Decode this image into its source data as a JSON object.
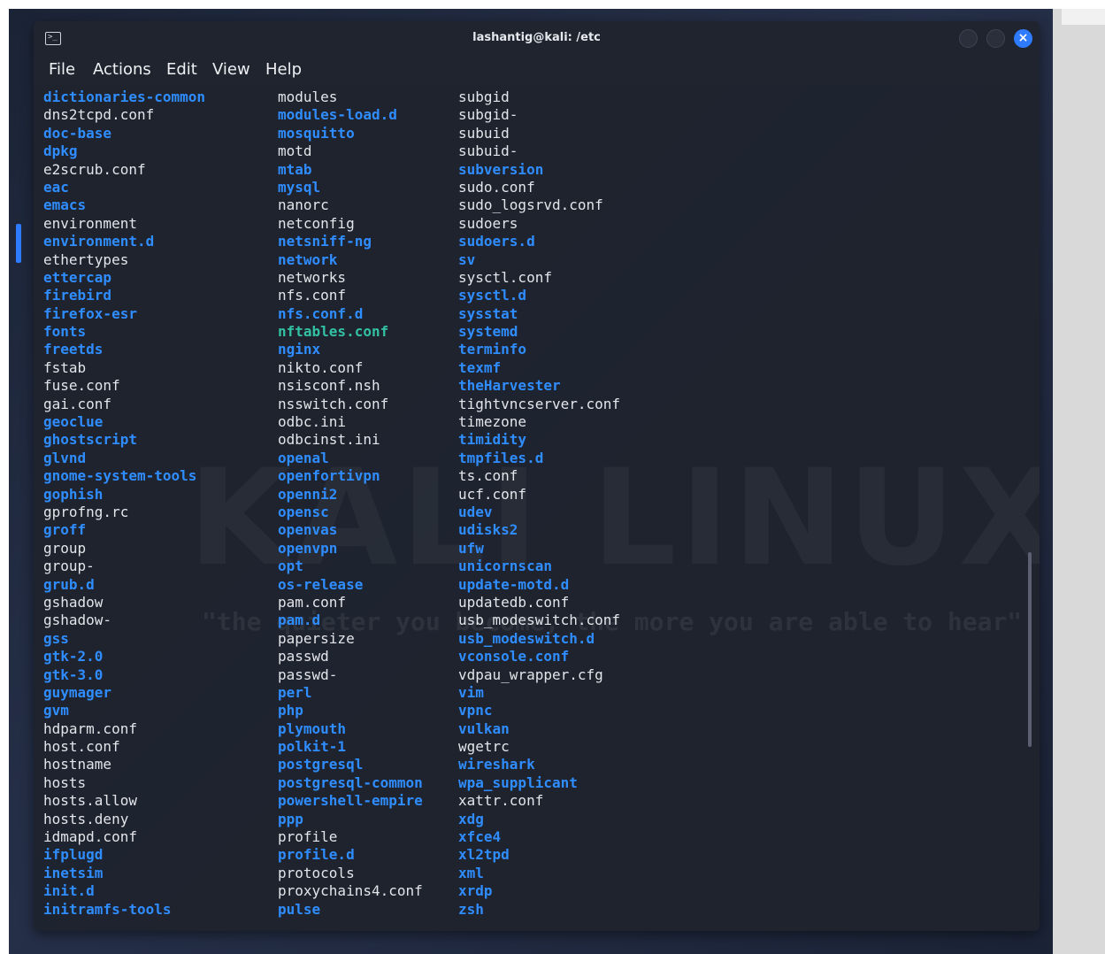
{
  "window": {
    "title": "lashantig@kali: /etc",
    "close_symbol": "×"
  },
  "menu": [
    "File",
    "Actions",
    "Edit",
    "View",
    "Help"
  ],
  "watermark": "KALI LINUX",
  "quote": "\"the quieter you become, the more you are able to hear\"",
  "colors": {
    "directory": "#2f8dff",
    "file": "#e3e5ea",
    "symlink": "#33c1a4",
    "accent": "#2f7bff"
  },
  "columns": [
    [
      {
        "name": "dictionaries-common",
        "type": "dir"
      },
      {
        "name": "dns2tcpd.conf",
        "type": "file"
      },
      {
        "name": "doc-base",
        "type": "dir"
      },
      {
        "name": "dpkg",
        "type": "dir"
      },
      {
        "name": "e2scrub.conf",
        "type": "file"
      },
      {
        "name": "eac",
        "type": "dir"
      },
      {
        "name": "emacs",
        "type": "dir"
      },
      {
        "name": "environment",
        "type": "file"
      },
      {
        "name": "environment.d",
        "type": "dir"
      },
      {
        "name": "ethertypes",
        "type": "file"
      },
      {
        "name": "ettercap",
        "type": "dir"
      },
      {
        "name": "firebird",
        "type": "dir"
      },
      {
        "name": "firefox-esr",
        "type": "dir"
      },
      {
        "name": "fonts",
        "type": "dir"
      },
      {
        "name": "freetds",
        "type": "dir"
      },
      {
        "name": "fstab",
        "type": "file"
      },
      {
        "name": "fuse.conf",
        "type": "file"
      },
      {
        "name": "gai.conf",
        "type": "file"
      },
      {
        "name": "geoclue",
        "type": "dir"
      },
      {
        "name": "ghostscript",
        "type": "dir"
      },
      {
        "name": "glvnd",
        "type": "dir"
      },
      {
        "name": "gnome-system-tools",
        "type": "dir"
      },
      {
        "name": "gophish",
        "type": "dir"
      },
      {
        "name": "gprofng.rc",
        "type": "file"
      },
      {
        "name": "groff",
        "type": "dir"
      },
      {
        "name": "group",
        "type": "file"
      },
      {
        "name": "group-",
        "type": "file"
      },
      {
        "name": "grub.d",
        "type": "dir"
      },
      {
        "name": "gshadow",
        "type": "file"
      },
      {
        "name": "gshadow-",
        "type": "file"
      },
      {
        "name": "gss",
        "type": "dir"
      },
      {
        "name": "gtk-2.0",
        "type": "dir"
      },
      {
        "name": "gtk-3.0",
        "type": "dir"
      },
      {
        "name": "guymager",
        "type": "dir"
      },
      {
        "name": "gvm",
        "type": "dir"
      },
      {
        "name": "hdparm.conf",
        "type": "file"
      },
      {
        "name": "host.conf",
        "type": "file"
      },
      {
        "name": "hostname",
        "type": "file"
      },
      {
        "name": "hosts",
        "type": "file"
      },
      {
        "name": "hosts.allow",
        "type": "file"
      },
      {
        "name": "hosts.deny",
        "type": "file"
      },
      {
        "name": "idmapd.conf",
        "type": "file"
      },
      {
        "name": "ifplugd",
        "type": "dir"
      },
      {
        "name": "inetsim",
        "type": "dir"
      },
      {
        "name": "init.d",
        "type": "dir"
      },
      {
        "name": "initramfs-tools",
        "type": "dir"
      }
    ],
    [
      {
        "name": "modules",
        "type": "file"
      },
      {
        "name": "modules-load.d",
        "type": "dir"
      },
      {
        "name": "mosquitto",
        "type": "dir"
      },
      {
        "name": "motd",
        "type": "file"
      },
      {
        "name": "mtab",
        "type": "dir"
      },
      {
        "name": "mysql",
        "type": "dir"
      },
      {
        "name": "nanorc",
        "type": "file"
      },
      {
        "name": "netconfig",
        "type": "file"
      },
      {
        "name": "netsniff-ng",
        "type": "dir"
      },
      {
        "name": "network",
        "type": "dir"
      },
      {
        "name": "networks",
        "type": "file"
      },
      {
        "name": "nfs.conf",
        "type": "file"
      },
      {
        "name": "nfs.conf.d",
        "type": "dir"
      },
      {
        "name": "nftables.conf",
        "type": "link"
      },
      {
        "name": "nginx",
        "type": "dir"
      },
      {
        "name": "nikto.conf",
        "type": "file"
      },
      {
        "name": "nsisconf.nsh",
        "type": "file"
      },
      {
        "name": "nsswitch.conf",
        "type": "file"
      },
      {
        "name": "odbc.ini",
        "type": "file"
      },
      {
        "name": "odbcinst.ini",
        "type": "file"
      },
      {
        "name": "openal",
        "type": "dir"
      },
      {
        "name": "openfortivpn",
        "type": "dir"
      },
      {
        "name": "openni2",
        "type": "dir"
      },
      {
        "name": "opensc",
        "type": "dir"
      },
      {
        "name": "openvas",
        "type": "dir"
      },
      {
        "name": "openvpn",
        "type": "dir"
      },
      {
        "name": "opt",
        "type": "dir"
      },
      {
        "name": "os-release",
        "type": "dir"
      },
      {
        "name": "pam.conf",
        "type": "file"
      },
      {
        "name": "pam.d",
        "type": "dir"
      },
      {
        "name": "papersize",
        "type": "file"
      },
      {
        "name": "passwd",
        "type": "file"
      },
      {
        "name": "passwd-",
        "type": "file"
      },
      {
        "name": "perl",
        "type": "dir"
      },
      {
        "name": "php",
        "type": "dir"
      },
      {
        "name": "plymouth",
        "type": "dir"
      },
      {
        "name": "polkit-1",
        "type": "dir"
      },
      {
        "name": "postgresql",
        "type": "dir"
      },
      {
        "name": "postgresql-common",
        "type": "dir"
      },
      {
        "name": "powershell-empire",
        "type": "dir"
      },
      {
        "name": "ppp",
        "type": "dir"
      },
      {
        "name": "profile",
        "type": "file"
      },
      {
        "name": "profile.d",
        "type": "dir"
      },
      {
        "name": "protocols",
        "type": "file"
      },
      {
        "name": "proxychains4.conf",
        "type": "file"
      },
      {
        "name": "pulse",
        "type": "dir"
      }
    ],
    [
      {
        "name": "subgid",
        "type": "file"
      },
      {
        "name": "subgid-",
        "type": "file"
      },
      {
        "name": "subuid",
        "type": "file"
      },
      {
        "name": "subuid-",
        "type": "file"
      },
      {
        "name": "subversion",
        "type": "dir"
      },
      {
        "name": "sudo.conf",
        "type": "file"
      },
      {
        "name": "sudo_logsrvd.conf",
        "type": "file"
      },
      {
        "name": "sudoers",
        "type": "file"
      },
      {
        "name": "sudoers.d",
        "type": "dir"
      },
      {
        "name": "sv",
        "type": "dir"
      },
      {
        "name": "sysctl.conf",
        "type": "file"
      },
      {
        "name": "sysctl.d",
        "type": "dir"
      },
      {
        "name": "sysstat",
        "type": "dir"
      },
      {
        "name": "systemd",
        "type": "dir"
      },
      {
        "name": "terminfo",
        "type": "dir"
      },
      {
        "name": "texmf",
        "type": "dir"
      },
      {
        "name": "theHarvester",
        "type": "dir"
      },
      {
        "name": "tightvncserver.conf",
        "type": "file"
      },
      {
        "name": "timezone",
        "type": "file"
      },
      {
        "name": "timidity",
        "type": "dir"
      },
      {
        "name": "tmpfiles.d",
        "type": "dir"
      },
      {
        "name": "ts.conf",
        "type": "file"
      },
      {
        "name": "ucf.conf",
        "type": "file"
      },
      {
        "name": "udev",
        "type": "dir"
      },
      {
        "name": "udisks2",
        "type": "dir"
      },
      {
        "name": "ufw",
        "type": "dir"
      },
      {
        "name": "unicornscan",
        "type": "dir"
      },
      {
        "name": "update-motd.d",
        "type": "dir"
      },
      {
        "name": "updatedb.conf",
        "type": "file"
      },
      {
        "name": "usb_modeswitch.conf",
        "type": "file"
      },
      {
        "name": "usb_modeswitch.d",
        "type": "dir"
      },
      {
        "name": "vconsole.conf",
        "type": "dir"
      },
      {
        "name": "vdpau_wrapper.cfg",
        "type": "file"
      },
      {
        "name": "vim",
        "type": "dir"
      },
      {
        "name": "vpnc",
        "type": "dir"
      },
      {
        "name": "vulkan",
        "type": "dir"
      },
      {
        "name": "wgetrc",
        "type": "file"
      },
      {
        "name": "wireshark",
        "type": "dir"
      },
      {
        "name": "wpa_supplicant",
        "type": "dir"
      },
      {
        "name": "xattr.conf",
        "type": "file"
      },
      {
        "name": "xdg",
        "type": "dir"
      },
      {
        "name": "xfce4",
        "type": "dir"
      },
      {
        "name": "xl2tpd",
        "type": "dir"
      },
      {
        "name": "xml",
        "type": "dir"
      },
      {
        "name": "xrdp",
        "type": "dir"
      },
      {
        "name": "zsh",
        "type": "dir"
      }
    ]
  ]
}
